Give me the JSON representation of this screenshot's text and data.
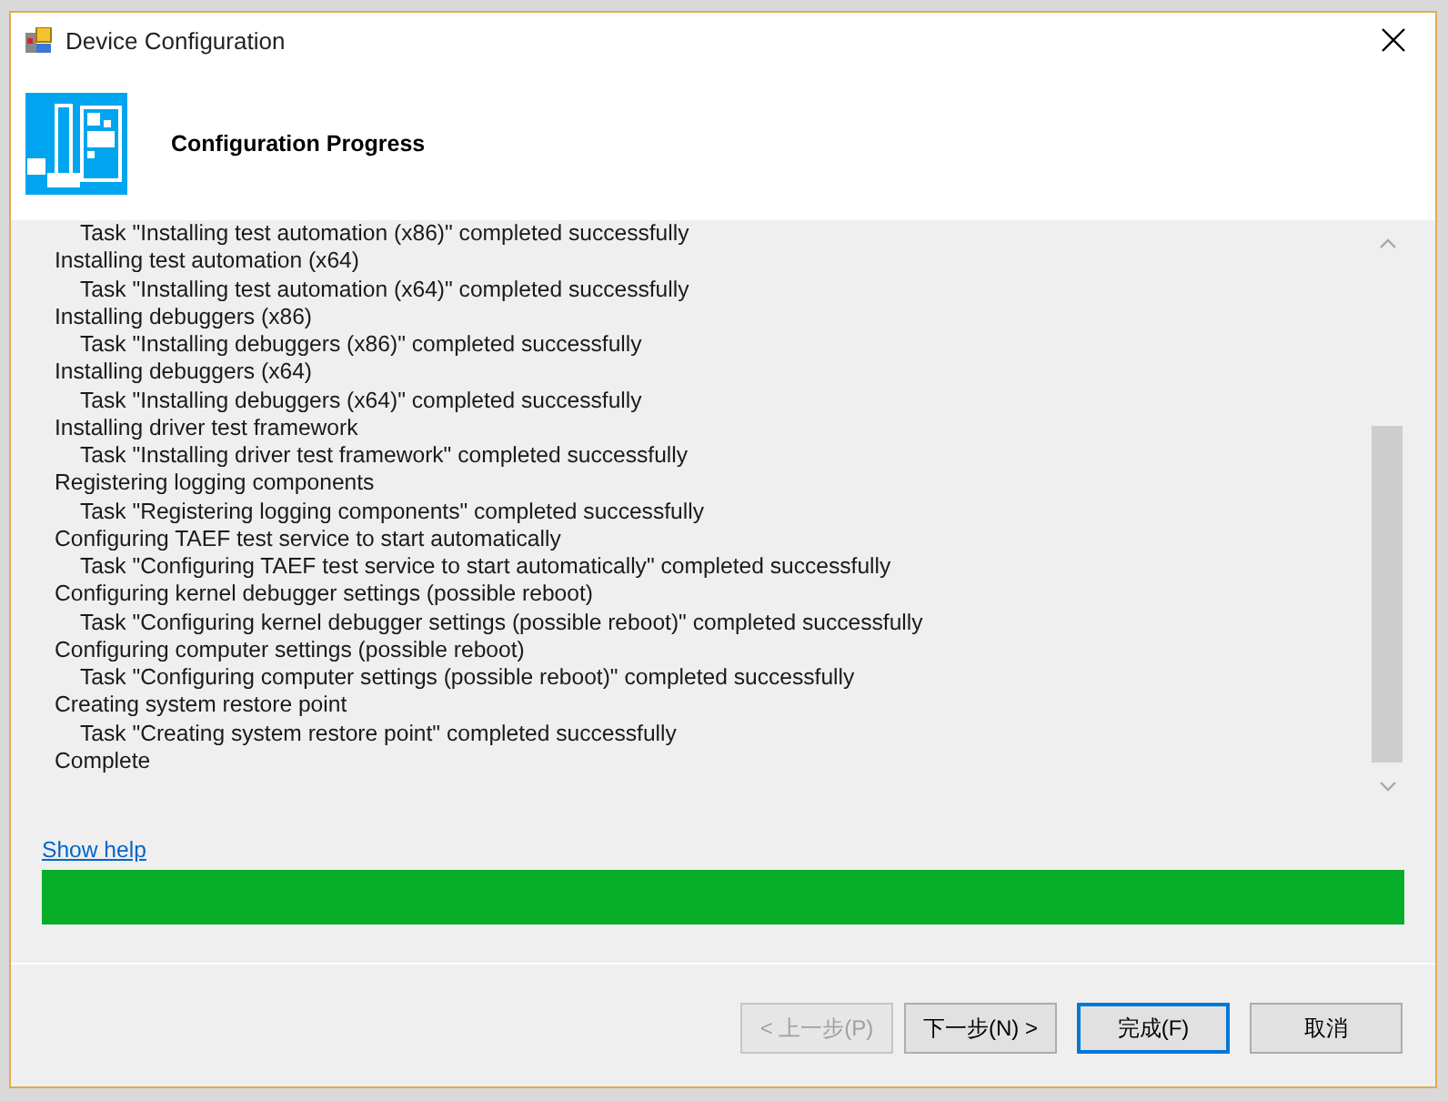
{
  "window": {
    "title": "Device Configuration"
  },
  "header": {
    "title": "Configuration Progress"
  },
  "log": [
    {
      "children": [
        {
          "text": "Task \"Installing test automation (x86)\" completed successfully"
        }
      ]
    },
    {
      "text": "Installing test automation (x64)",
      "children": [
        {
          "text": "Task \"Installing test automation (x64)\" completed successfully"
        }
      ]
    },
    {
      "text": "Installing debuggers (x86)",
      "children": [
        {
          "text": "Task \"Installing debuggers (x86)\" completed successfully"
        }
      ]
    },
    {
      "text": "Installing debuggers (x64)",
      "children": [
        {
          "text": "Task \"Installing debuggers (x64)\" completed successfully"
        }
      ]
    },
    {
      "text": "Installing driver test framework",
      "children": [
        {
          "text": "Task \"Installing driver test framework\" completed successfully"
        }
      ]
    },
    {
      "text": "Registering logging components",
      "children": [
        {
          "text": "Task \"Registering logging components\" completed successfully"
        }
      ]
    },
    {
      "text": "Configuring TAEF test service to start automatically",
      "children": [
        {
          "text": "Task \"Configuring TAEF test service to start automatically\" completed successfully"
        }
      ]
    },
    {
      "text": "Configuring kernel debugger settings (possible reboot)",
      "children": [
        {
          "text": "Task \"Configuring kernel debugger settings (possible reboot)\" completed successfully"
        }
      ]
    },
    {
      "text": "Configuring computer settings (possible reboot)",
      "children": [
        {
          "text": "Task \"Configuring computer settings (possible reboot)\" completed successfully"
        }
      ]
    },
    {
      "text": "Creating system restore point",
      "children": [
        {
          "text": "Task \"Creating system restore point\" completed successfully"
        }
      ]
    },
    {
      "text": "Complete"
    }
  ],
  "help_link": "Show help",
  "progress": {
    "level": 1
  },
  "buttons": [
    {
      "label": "< 上一步(P)",
      "disabled": true,
      "default": false
    },
    {
      "label": "下一步(N) >",
      "disabled": false,
      "default": false
    },
    {
      "label": "完成(F)",
      "disabled": false,
      "default": true
    },
    {
      "label": "取消",
      "disabled": false,
      "default": false
    }
  ]
}
